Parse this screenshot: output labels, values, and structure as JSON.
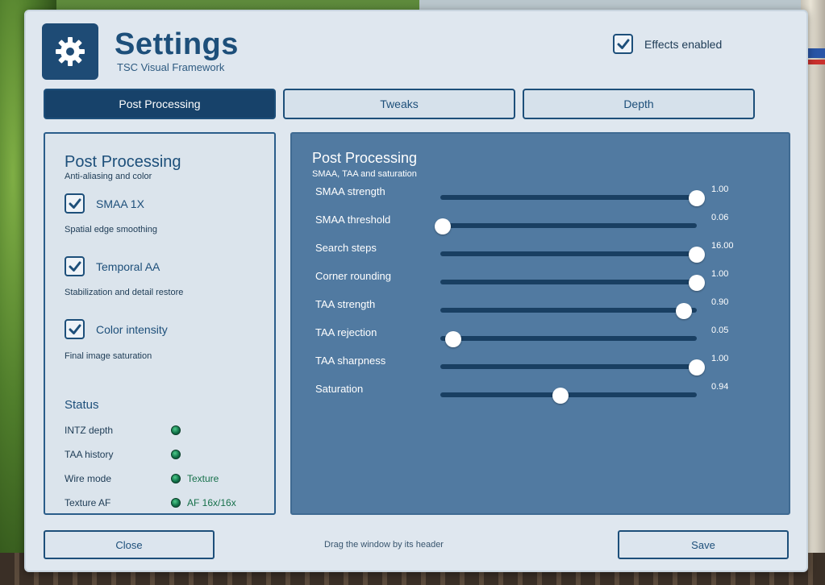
{
  "header": {
    "title": "Settings",
    "subtitle": "TSC Visual Framework",
    "logo_icon": "gear-icon",
    "effects_label": "Effects enabled",
    "effects_checked": true
  },
  "tabs": [
    {
      "label": "Post Processing",
      "active": true
    },
    {
      "label": "Tweaks",
      "active": false
    },
    {
      "label": "Depth",
      "active": false
    }
  ],
  "left_panel": {
    "title": "Post Processing",
    "subtitle": "Anti-aliasing and color",
    "options": [
      {
        "label": "SMAA 1X",
        "description": "Spatial edge smoothing",
        "checked": true
      },
      {
        "label": "Temporal AA",
        "description": "Stabilization and detail restore",
        "checked": true
      },
      {
        "label": "Color intensity",
        "description": "Final image saturation",
        "checked": true
      }
    ],
    "status_title": "Status",
    "status": [
      {
        "label": "INTZ depth",
        "value": ""
      },
      {
        "label": "TAA history",
        "value": ""
      },
      {
        "label": "Wire mode",
        "value": "Texture"
      },
      {
        "label": "Texture AF",
        "value": "AF 16x/16x"
      }
    ],
    "status_color": "#16704a"
  },
  "right_panel": {
    "title": "Post Processing",
    "subtitle": "SMAA, TAA and saturation",
    "sliders": [
      {
        "label": "SMAA strength",
        "value": "1.00",
        "fraction": 1.0
      },
      {
        "label": "SMAA threshold",
        "value": "0.06",
        "fraction": 0.01
      },
      {
        "label": "Search steps",
        "value": "16.00",
        "fraction": 1.0
      },
      {
        "label": "Corner rounding",
        "value": "1.00",
        "fraction": 1.0
      },
      {
        "label": "TAA strength",
        "value": "0.90",
        "fraction": 0.95
      },
      {
        "label": "TAA rejection",
        "value": "0.05",
        "fraction": 0.05
      },
      {
        "label": "TAA sharpness",
        "value": "1.00",
        "fraction": 1.0
      },
      {
        "label": "Saturation",
        "value": "0.94",
        "fraction": 0.47
      }
    ]
  },
  "footer": {
    "close_label": "Close",
    "hint": "Drag the window by its header",
    "save_label": "Save"
  },
  "colors": {
    "accent": "#1d4f7a",
    "active_tab": "#17426a",
    "panel_blue": "#517aa1",
    "window_bg": "#dfe7ef"
  }
}
